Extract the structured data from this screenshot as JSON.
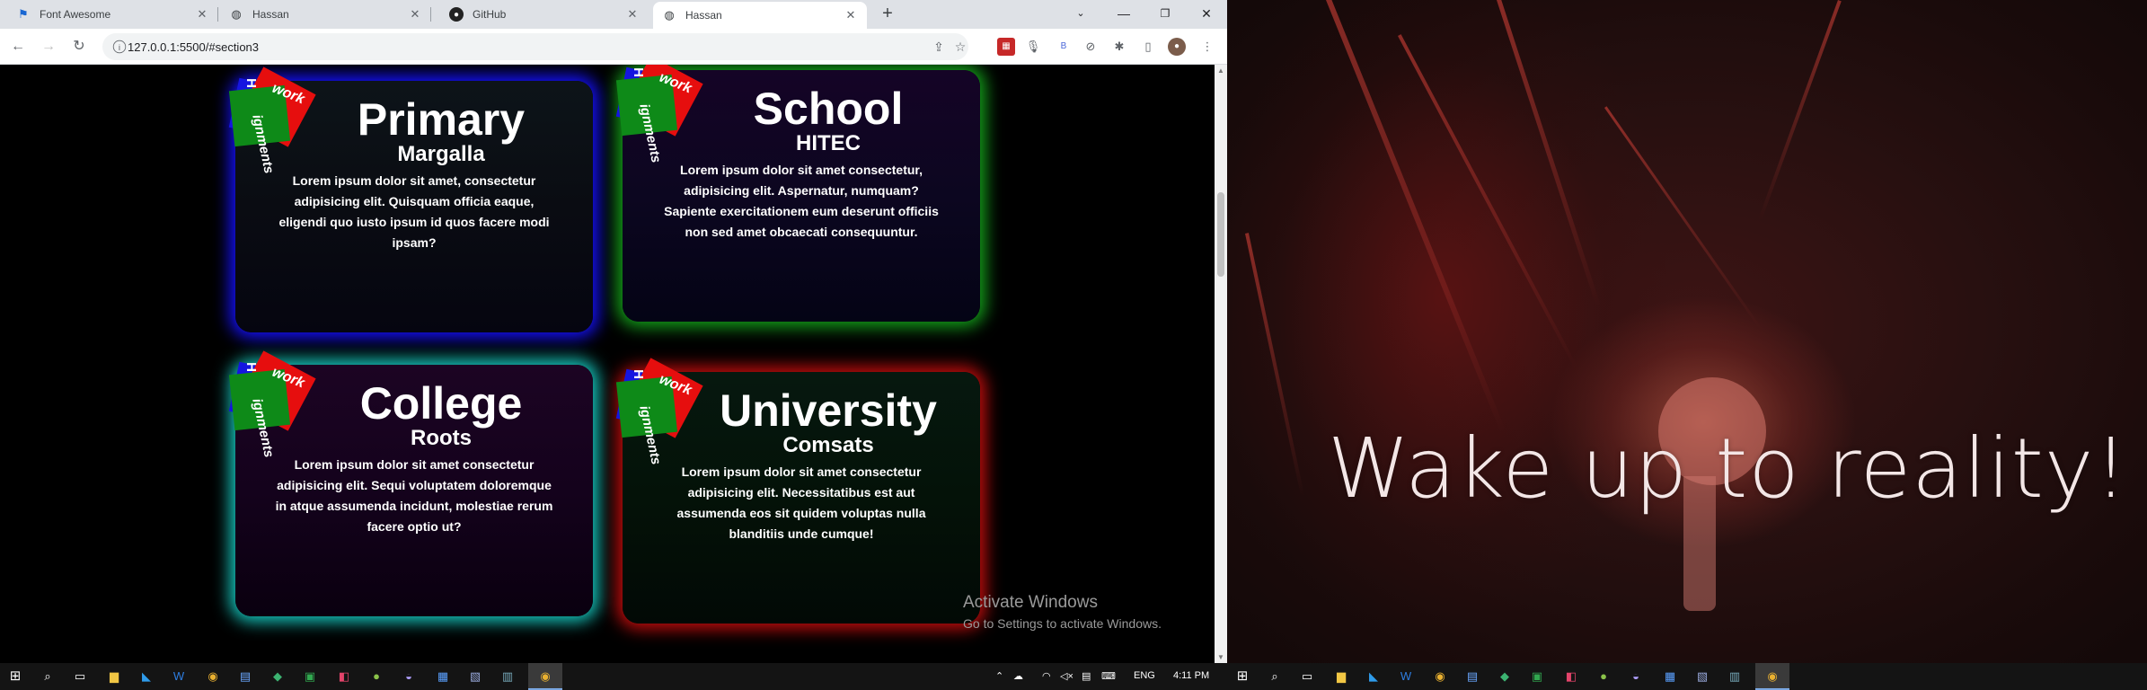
{
  "browser": {
    "tabs": [
      {
        "label": "Font Awesome",
        "icon": "flag-icon",
        "active": false
      },
      {
        "label": "Hassan",
        "icon": "globe-icon",
        "active": false
      },
      {
        "label": "GitHub",
        "icon": "github-icon",
        "active": false
      },
      {
        "label": "Hassan",
        "icon": "globe-icon",
        "active": true
      }
    ],
    "new_tab": "+",
    "url": "127.0.0.1:5500/#section3"
  },
  "cards": [
    {
      "title": "Primary",
      "subtitle": "Margalla",
      "subtitle_color": "#ffffff",
      "glow": "#1511ff",
      "body": "Lorem ipsum dolor sit amet, consectetur adipisicing elit. Quisquam officia eaque, eligendi quo iusto ipsum id quos facere modi ipsam?"
    },
    {
      "title": "School",
      "subtitle": "HITEC",
      "subtitle_color": "#ffffff",
      "glow": "#14a31b",
      "body": "Lorem ipsum dolor sit amet consectetur, adipisicing elit. Aspernatur, numquam? Sapiente exercitationem eum deserunt officiis non sed amet obcaecati consequuntur."
    },
    {
      "title": "College",
      "subtitle": "Roots",
      "subtitle_color": "#ffffff",
      "glow": "#16c9c0",
      "body": "Lorem ipsum dolor sit amet consectetur adipisicing elit. Sequi voluptatem doloremque in atque assumenda incidunt, molestiae rerum facere optio ut?"
    },
    {
      "title": "University",
      "subtitle": "Comsats",
      "subtitle_color": "#ffffff",
      "glow": "#c40d0d",
      "body": "Lorem ipsum dolor sit amet consectetur adipisicing elit. Necessitatibus est aut assumenda eos sit quidem voluptas nulla blanditiis unde cumque!"
    }
  ],
  "badge": {
    "line1": "H",
    "line2": "work",
    "line3": "ignments"
  },
  "watermark": {
    "line1": "Activate Windows",
    "line2": "Go to Settings to activate Windows."
  },
  "taskbar": {
    "language": "ENG",
    "time": "4:11 PM"
  },
  "wallpaper": {
    "text": "Wake up to reality!"
  }
}
